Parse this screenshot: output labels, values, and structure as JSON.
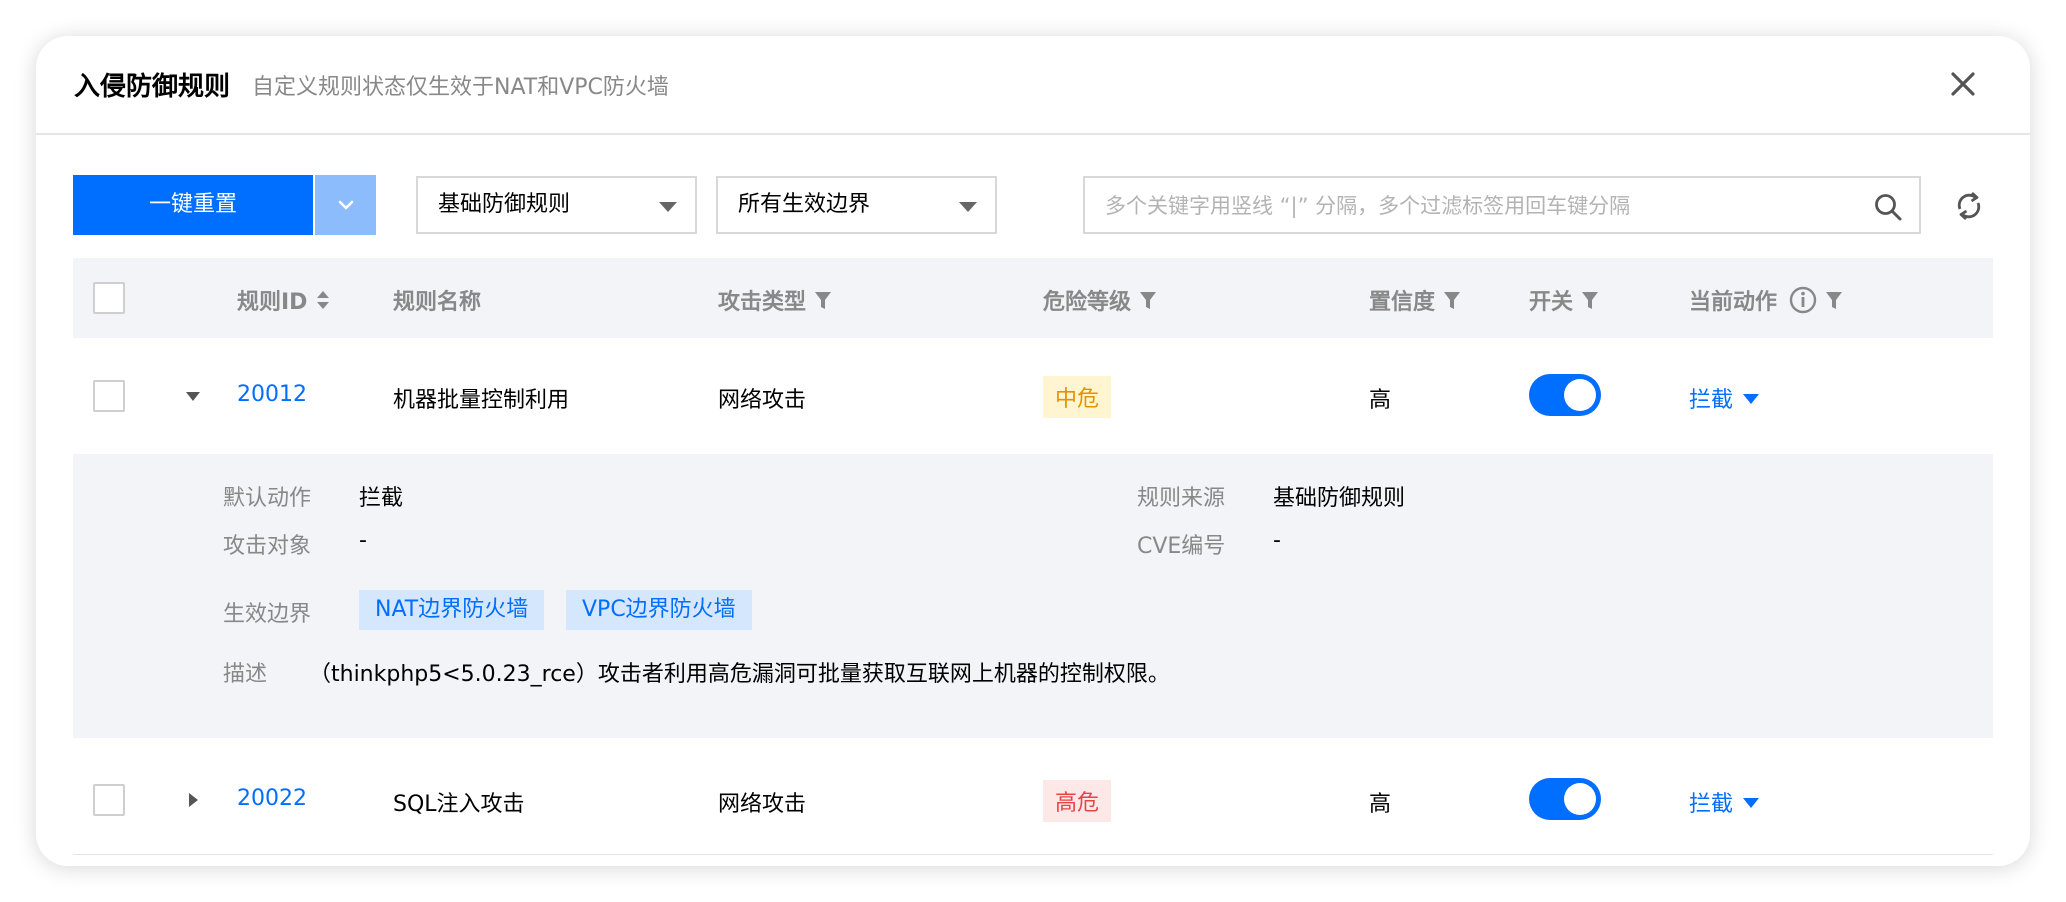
{
  "dialog": {
    "title": "入侵防御规则",
    "subtitle": "自定义规则状态仅生效于NAT和VPC防火墙"
  },
  "toolbar": {
    "reset_label": "一键重置",
    "rule_type_select": "基础防御规则",
    "boundary_select": "所有生效边界",
    "search_placeholder": "多个关键字用竖线 “|” 分隔，多个过滤标签用回车键分隔"
  },
  "table": {
    "headers": {
      "rule_id": "规则ID",
      "rule_name": "规则名称",
      "attack_type": "攻击类型",
      "risk_level": "危险等级",
      "confidence": "置信度",
      "switch": "开关",
      "current_action": "当前动作"
    },
    "rows": [
      {
        "id": "20012",
        "name": "机器批量控制利用",
        "attack_type": "网络攻击",
        "risk": "中危",
        "confidence": "高",
        "enabled": true,
        "action": "拦截",
        "expanded": true
      },
      {
        "id": "20022",
        "name": "SQL注入攻击",
        "attack_type": "网络攻击",
        "risk": "高危",
        "confidence": "高",
        "enabled": true,
        "action": "拦截",
        "expanded": false
      }
    ],
    "detail": {
      "default_action_label": "默认动作",
      "default_action_value": "拦截",
      "rule_source_label": "规则来源",
      "rule_source_value": "基础防御规则",
      "attack_target_label": "攻击对象",
      "attack_target_value": "-",
      "cve_label": "CVE编号",
      "cve_value": "-",
      "boundary_label": "生效边界",
      "boundaries": [
        "NAT边界防火墙",
        "VPC边界防火墙"
      ],
      "description_label": "描述",
      "description_value": "（thinkphp5<5.0.23_rce）攻击者利用高危漏洞可批量获取互联网上机器的控制权限。"
    }
  },
  "colors": {
    "primary": "#006eff",
    "warning": "#e59200",
    "danger": "#e54545"
  }
}
